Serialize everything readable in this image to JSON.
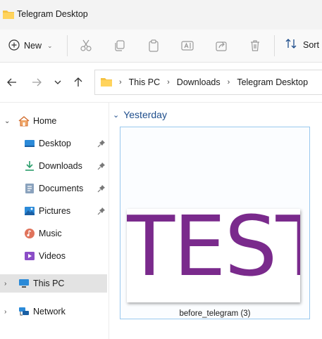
{
  "window": {
    "title": "Telegram Desktop"
  },
  "toolbar": {
    "new_label": "New",
    "sort_label": "Sort",
    "icons": [
      "cut-icon",
      "copy-icon",
      "paste-icon",
      "rename-icon",
      "share-icon",
      "delete-icon"
    ]
  },
  "address": {
    "crumbs": [
      "This PC",
      "Downloads",
      "Telegram Desktop"
    ]
  },
  "sidebar": {
    "items": [
      {
        "label": "Home",
        "icon": "home-icon",
        "expandable": true,
        "pinned": false
      },
      {
        "label": "Desktop",
        "icon": "desktop-icon",
        "pinned": true
      },
      {
        "label": "Downloads",
        "icon": "downloads-icon",
        "pinned": true
      },
      {
        "label": "Documents",
        "icon": "documents-icon",
        "pinned": true
      },
      {
        "label": "Pictures",
        "icon": "pictures-icon",
        "pinned": true
      },
      {
        "label": "Music",
        "icon": "music-icon",
        "pinned": false
      },
      {
        "label": "Videos",
        "icon": "videos-icon",
        "pinned": false
      },
      {
        "label": "This PC",
        "icon": "this-pc-icon",
        "expandable": true,
        "selected": true
      },
      {
        "label": "Network",
        "icon": "network-icon",
        "expandable": true
      }
    ]
  },
  "content": {
    "group_label": "Yesterday",
    "file": {
      "name": "before_telegram (3)",
      "thumbnail_text": "TEST"
    }
  },
  "colors": {
    "accent": "#1f4e8c",
    "selection_border": "#99c8ee",
    "thumbnail_text": "#7a2a8c"
  }
}
